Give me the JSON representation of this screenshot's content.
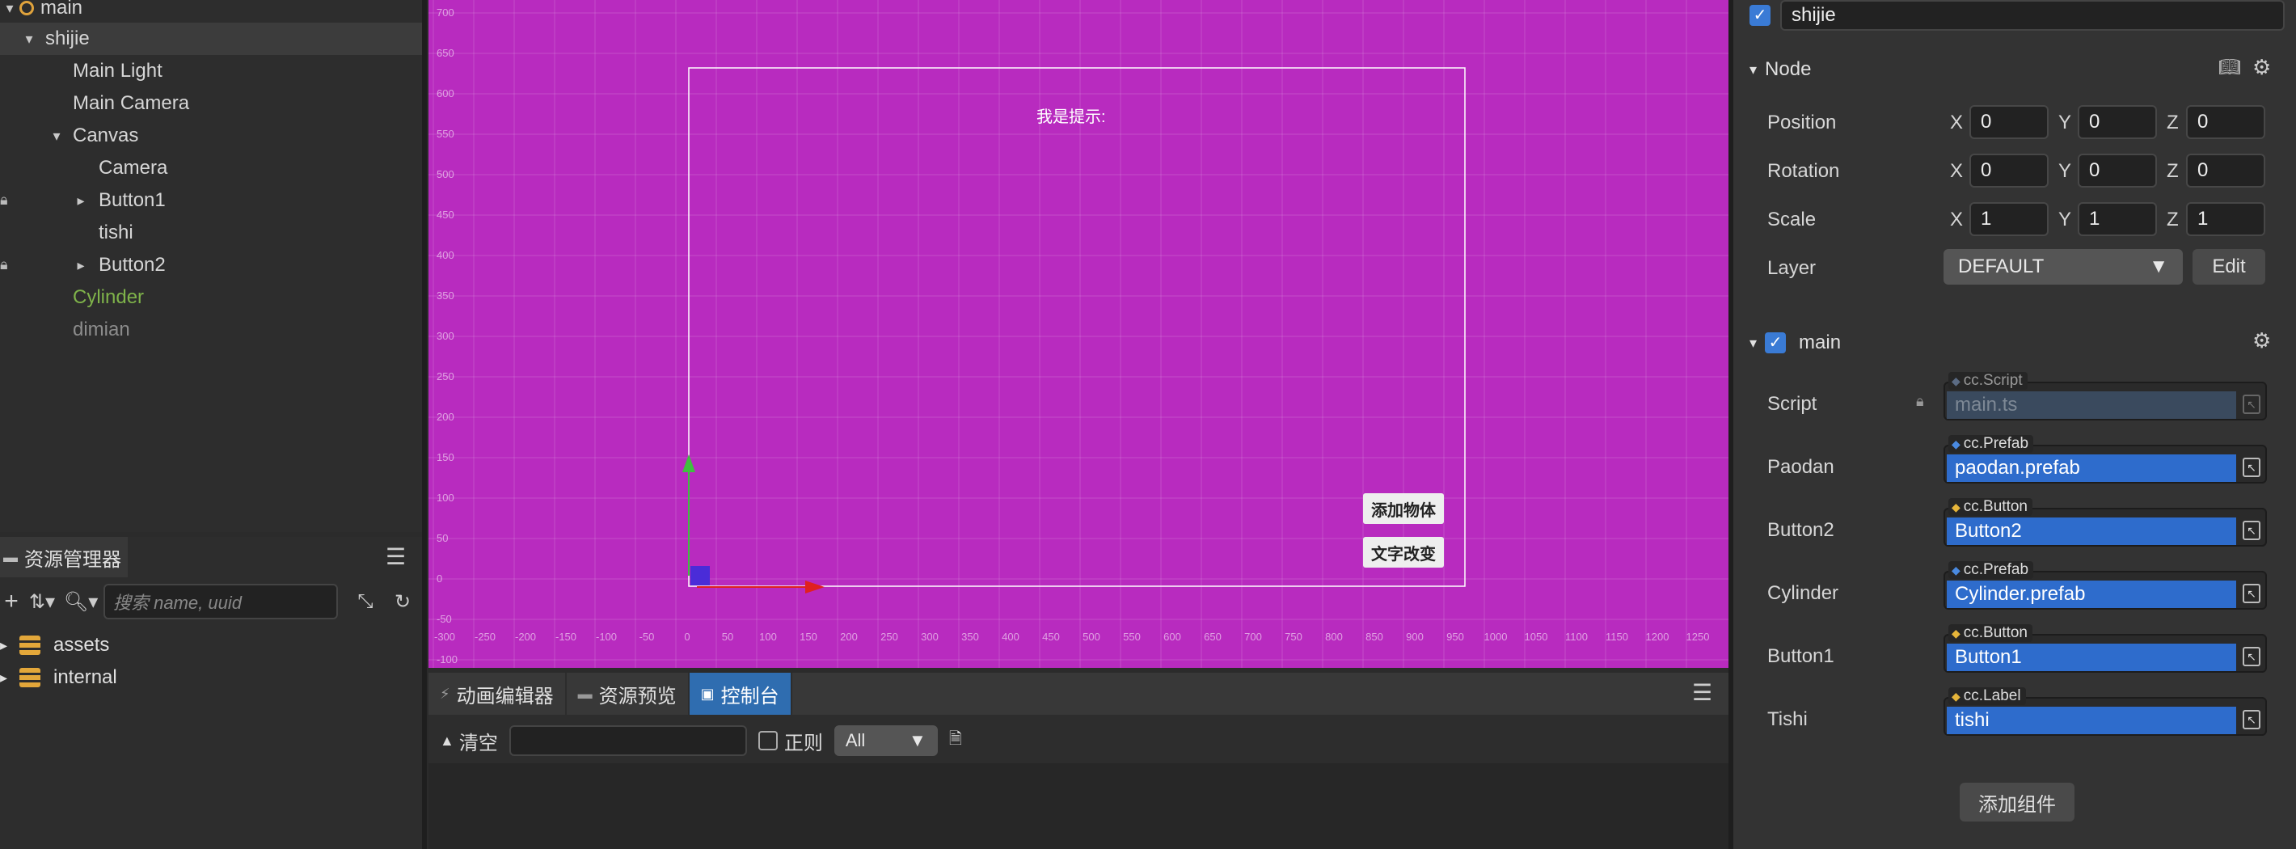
{
  "hierarchy": {
    "items": [
      {
        "label": "main",
        "name": "hier-item-main"
      },
      {
        "label": "shijie",
        "name": "hier-item-shijie"
      },
      {
        "label": "Main Light",
        "name": "hier-item-main-light"
      },
      {
        "label": "Main Camera",
        "name": "hier-item-main-camera"
      },
      {
        "label": "Canvas",
        "name": "hier-item-canvas"
      },
      {
        "label": "Camera",
        "name": "hier-item-camera"
      },
      {
        "label": "Button1",
        "name": "hier-item-button1"
      },
      {
        "label": "tishi",
        "name": "hier-item-tishi"
      },
      {
        "label": "Button2",
        "name": "hier-item-button2"
      },
      {
        "label": "Cylinder",
        "name": "hier-item-cylinder"
      },
      {
        "label": "dimian",
        "name": "hier-item-dimian"
      }
    ]
  },
  "assets": {
    "tab_label": "资源管理器",
    "search_placeholder": "搜索 name, uuid",
    "items": [
      {
        "label": "assets"
      },
      {
        "label": "internal"
      }
    ]
  },
  "scene": {
    "tip_text": "我是提示:",
    "button_add": "添加物体",
    "button_text": "文字改变",
    "background_color": "#b82bbf",
    "x_ticks": [
      "-300",
      "-250",
      "-200",
      "-150",
      "-100",
      "-50",
      "0",
      "50",
      "100",
      "150",
      "200",
      "250",
      "300",
      "350",
      "400",
      "450",
      "500",
      "550",
      "600",
      "650",
      "700",
      "750",
      "800",
      "850",
      "900",
      "950",
      "1000",
      "1050",
      "1100",
      "1150",
      "1200",
      "1250"
    ],
    "y_ticks": [
      "700",
      "650",
      "600",
      "550",
      "500",
      "450",
      "400",
      "350",
      "300",
      "250",
      "200",
      "150",
      "100",
      "50",
      "0",
      "-50",
      "-100"
    ]
  },
  "console": {
    "tabs": [
      {
        "label": "动画编辑器"
      },
      {
        "label": "资源预览"
      },
      {
        "label": "控制台"
      }
    ],
    "clear_label": "清空",
    "regex_label": "正则",
    "filter_value": "All"
  },
  "inspector": {
    "node_name": "shijie",
    "node_section": "Node",
    "position": {
      "label": "Position",
      "x": "0",
      "y": "0",
      "z": "0"
    },
    "rotation": {
      "label": "Rotation",
      "x": "0",
      "y": "0",
      "z": "0"
    },
    "scale": {
      "label": "Scale",
      "x": "1",
      "y": "1",
      "z": "1"
    },
    "axis_x": "X",
    "axis_y": "Y",
    "axis_z": "Z",
    "layer": {
      "label": "Layer",
      "value": "DEFAULT",
      "edit_label": "Edit"
    },
    "component_name": "main",
    "props": [
      {
        "label": "Script",
        "type": "cc.Script",
        "value": "main.ts",
        "tag_color": "#5b6b84"
      },
      {
        "label": "Paodan",
        "type": "cc.Prefab",
        "value": "paodan.prefab",
        "tag_color": "#4a8ae0"
      },
      {
        "label": "Button2",
        "type": "cc.Button",
        "value": "Button2",
        "tag_color": "#e6b53a"
      },
      {
        "label": "Cylinder",
        "type": "cc.Prefab",
        "value": "Cylinder.prefab",
        "tag_color": "#4a8ae0"
      },
      {
        "label": "Button1",
        "type": "cc.Button",
        "value": "Button1",
        "tag_color": "#e6b53a"
      },
      {
        "label": "Tishi",
        "type": "cc.Label",
        "value": "tishi",
        "tag_color": "#e6b53a"
      }
    ],
    "add_component_label": "添加组件"
  }
}
